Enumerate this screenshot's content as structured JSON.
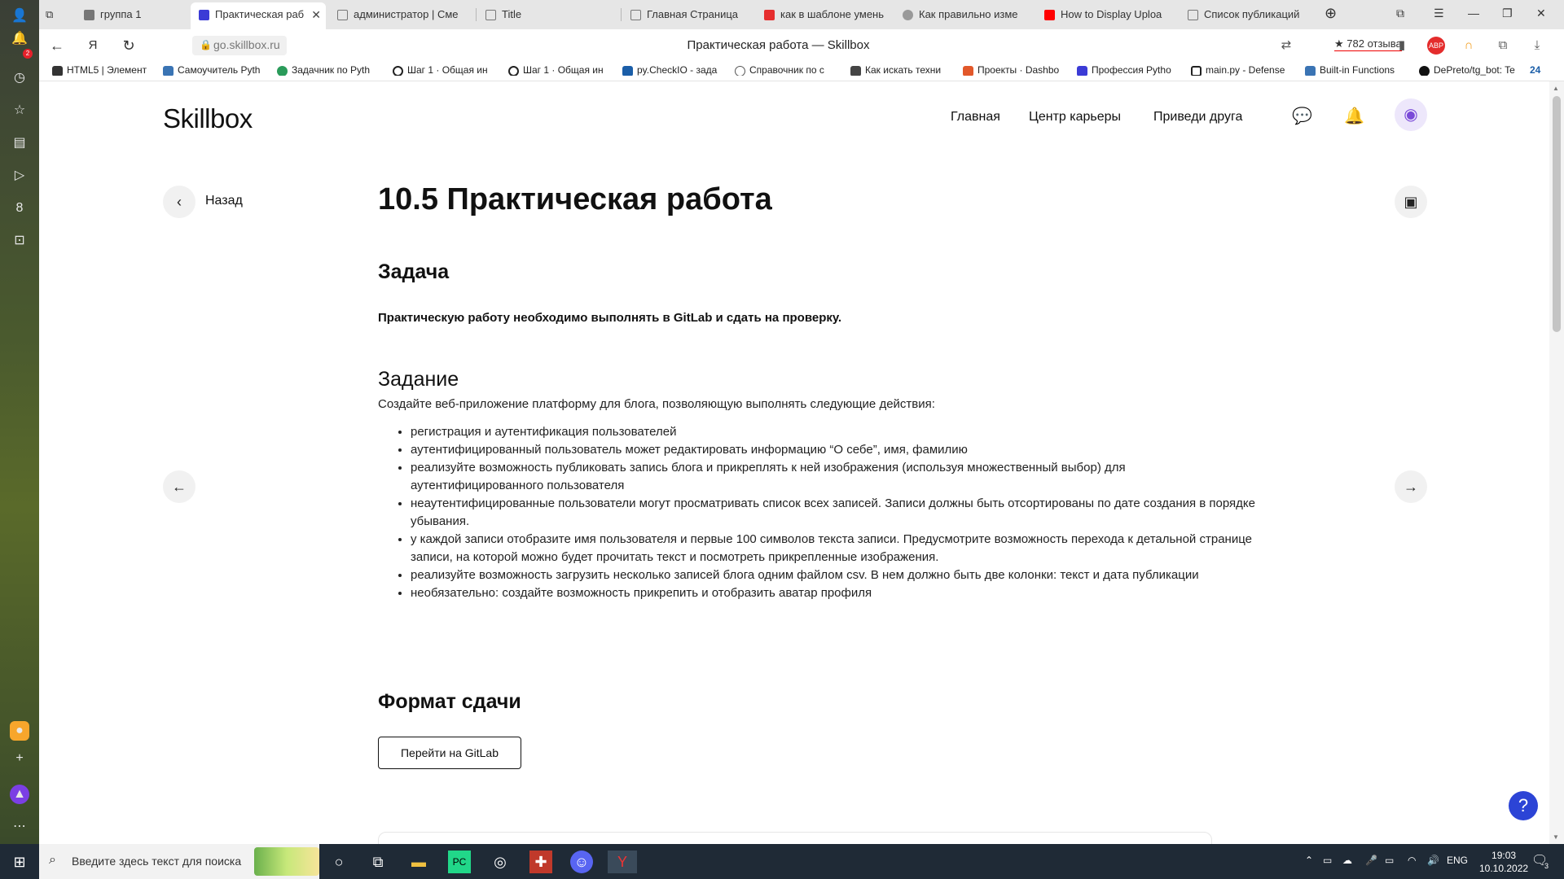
{
  "browser": {
    "tabs": [
      {
        "label": "группа 1"
      },
      {
        "label": "Практическая раб"
      },
      {
        "label": "администратор | Сме"
      },
      {
        "label": "Title"
      },
      {
        "label": "Главная Страница"
      },
      {
        "label": "как в шаблоне умень"
      },
      {
        "label": "Как правильно изме"
      },
      {
        "label": "How to Display Uploa"
      },
      {
        "label": "Список публикаций"
      }
    ],
    "url": "go.skillbox.ru",
    "page_title": "Практическая работа — Skillbox",
    "reviews": "★ 782 отзыва",
    "bookmark_count": "24",
    "bookmarks": [
      "HTML5 | Элемент",
      "Самоучитель Pyth",
      "Задачник по Pyth",
      "Шаг 1 · Общая ин",
      "Шаг 1 · Общая ин",
      "py.CheckIO - зада",
      "Справочник по с",
      "Как искать техни",
      "Проекты · Dashbo",
      "Профессия Pytho",
      "main.py - Defense",
      "Built-in Functions",
      "DePreto/tg_bot: Te"
    ],
    "sidebar_badge": "2",
    "sidebar_counter": "8"
  },
  "site": {
    "logo": "Skillbox",
    "nav": [
      "Главная",
      "Центр карьеры",
      "Приведи друга"
    ]
  },
  "content": {
    "back_label": "Назад",
    "title": "10.5 Практическая работа",
    "task_heading": "Задача",
    "task_text": "Практическую работу необходимо выполнять в GitLab и сдать на проверку.",
    "assignment_heading": "Задание",
    "assignment_intro": "Создайте веб-приложение платформу для блога, позволяющую выполнять следующие действия:",
    "items": [
      "регистрация и аутентификация пользователей",
      "аутентифицированный пользователь может редактировать информацию “О себе”, имя, фамилию",
      "реализуйте  возможность публиковать запись блога и прикреплять к ней изображения (используя множественный выбор)  для аутентифицированного пользователя",
      "неаутентифицированные пользователи могут просматривать список всех записей. Записи должны быть отсортированы по дате создания в порядке убывания.",
      "у каждой записи отобразите имя пользователя и первые 100 символов текста записи. Предусмотрите возможность перехода к детальной странице записи, на которой можно будет прочитать текст и посмотреть прикрепленные изображения.",
      "реализуйте возможность загрузить несколько записей блога одним файлом csv. В нем должно быть две колонки: текст и дата публикации",
      "необязательно: создайте возможность прикрепить и отобразить аватар профиля"
    ],
    "format_heading": "Формат сдачи",
    "gitlab_button": "Перейти на GitLab",
    "help_label": "?"
  },
  "taskbar": {
    "search_placeholder": "Введите здесь текст для поиска",
    "lang": "ENG",
    "time": "19:03",
    "date": "10.10.2022",
    "notif_count": "3"
  },
  "colors": {
    "accent": "#2c44d6",
    "avatar_bg": "#ede7fb",
    "taskbar": "#1f2a36"
  }
}
